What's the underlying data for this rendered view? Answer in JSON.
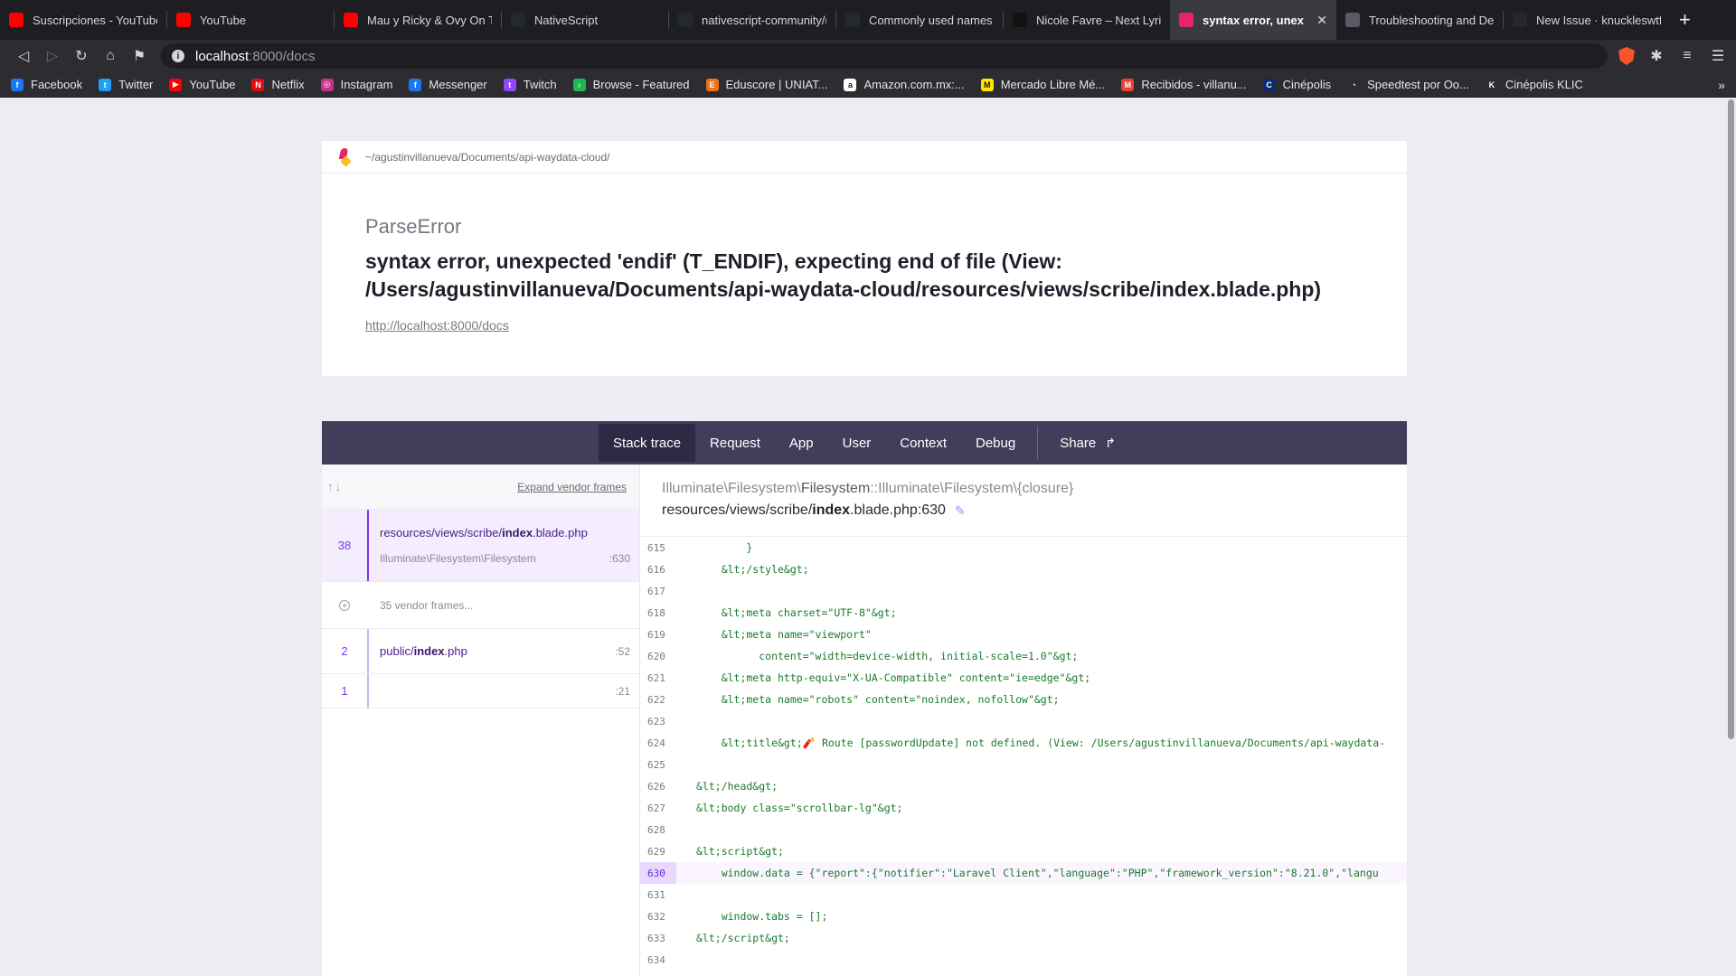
{
  "browser": {
    "tabs": [
      {
        "title": "Suscripciones - YouTube",
        "icon": "youtube-icon",
        "color": "#ff0000"
      },
      {
        "title": "YouTube",
        "icon": "youtube-icon",
        "color": "#ff0000"
      },
      {
        "title": "Mau y Ricky & Ovy On The",
        "icon": "youtube-icon",
        "color": "#ff0000"
      },
      {
        "title": "NativeScript",
        "icon": "github-icon",
        "color": "#24292e"
      },
      {
        "title": "nativescript-community/u",
        "icon": "github-icon",
        "color": "#24292e"
      },
      {
        "title": "Commonly used names fo",
        "icon": "github-icon",
        "color": "#24292e"
      },
      {
        "title": "Nicole Favre – Next Lyrics",
        "icon": "genius-icon",
        "color": "#111111"
      },
      {
        "title": "syntax error, unex",
        "icon": "ignition-icon",
        "color": "#e7236d",
        "active": true
      },
      {
        "title": "Troubleshooting and Deb",
        "icon": "docs-icon",
        "color": "#5a5a66"
      },
      {
        "title": "New Issue · knuckleswtf/s",
        "icon": "github-icon",
        "color": "#24292e"
      }
    ],
    "close_glyph": "✕",
    "newtab_glyph": "+",
    "url_host": "localhost",
    "url_path": ":8000/docs",
    "bookmarks": [
      {
        "label": "Facebook",
        "color": "#1877f2",
        "glyph": "f"
      },
      {
        "label": "Twitter",
        "color": "#1da1f2",
        "glyph": "t"
      },
      {
        "label": "YouTube",
        "color": "#ff0000",
        "glyph": "▶"
      },
      {
        "label": "Netflix",
        "color": "#e50914",
        "glyph": "N"
      },
      {
        "label": "Instagram",
        "color": "#c13584",
        "glyph": "◎"
      },
      {
        "label": "Messenger",
        "color": "#1877f2",
        "glyph": "f"
      },
      {
        "label": "Twitch",
        "color": "#9146ff",
        "glyph": "t"
      },
      {
        "label": "Browse - Featured",
        "color": "#1db954",
        "glyph": "♪"
      },
      {
        "label": "Eduscore | UNIAT...",
        "color": "#e8731a",
        "glyph": "E"
      },
      {
        "label": "Amazon.com.mx:...",
        "color": "#ffffff",
        "glyph": "a"
      },
      {
        "label": "Mercado Libre Mé...",
        "color": "#ffe600",
        "glyph": "M"
      },
      {
        "label": "Recibidos - villanu...",
        "color": "#ea4335",
        "glyph": "M"
      },
      {
        "label": "Cinépolis",
        "color": "#0a2a6b",
        "glyph": "C"
      },
      {
        "label": "Speedtest por Oo...",
        "color": "#2d2d31",
        "glyph": "◔"
      },
      {
        "label": "Cinépolis KLIC",
        "color": "#2d2d31",
        "glyph": "K"
      }
    ],
    "bookmarks_more": "»"
  },
  "error": {
    "path": "~/agustinvillanueva/Documents/api-waydata-cloud/",
    "class": "ParseError",
    "message": "syntax error, unexpected 'endif' (T_ENDIF), expecting end of file (View: /Users/agustinvillanueva/Documents/api-waydata-cloud/resources/views/scribe/index.blade.php)",
    "url": "http://localhost:8000/docs"
  },
  "stack_tabs": [
    "Stack trace",
    "Request",
    "App",
    "User",
    "Context",
    "Debug"
  ],
  "share_label": "Share",
  "frames_panel": {
    "expand_label": "Expand vendor frames",
    "frames": [
      {
        "num": "38",
        "file_pre": "resources/views/scribe/",
        "file_bold": "index",
        "file_post": ".blade.php",
        "class": "Illuminate\\Filesystem\\Filesystem",
        "line": ":630",
        "selected": true
      },
      {
        "num": "",
        "vendor": true,
        "label": "35 vendor frames..."
      },
      {
        "num": "2",
        "file_pre": "public/",
        "file_bold": "index",
        "file_post": ".php",
        "line": ":52"
      },
      {
        "num": "1",
        "file_pre": "",
        "file_bold": "",
        "file_post": "",
        "line": ":21"
      }
    ]
  },
  "code": {
    "class_pre": "Illuminate\\Filesystem\\",
    "class_bold": "Filesystem",
    "class_post": "::Illuminate\\Filesystem\\{closure}",
    "file_pre": "resources/views/scribe/",
    "file_bold": "index",
    "file_post": ".blade.php:630",
    "highlight_line": "630",
    "lines": [
      {
        "n": "615",
        "t": "        }"
      },
      {
        "n": "616",
        "t": "    &lt;/style&gt;"
      },
      {
        "n": "617",
        "t": ""
      },
      {
        "n": "618",
        "t": "    &lt;meta charset=\"UTF-8\"&gt;"
      },
      {
        "n": "619",
        "t": "    &lt;meta name=\"viewport\""
      },
      {
        "n": "620",
        "t": "          content=\"width=device-width, initial-scale=1.0\"&gt;"
      },
      {
        "n": "621",
        "t": "    &lt;meta http-equiv=\"X-UA-Compatible\" content=\"ie=edge\"&gt;"
      },
      {
        "n": "622",
        "t": "    &lt;meta name=\"robots\" content=\"noindex, nofollow\"&gt;"
      },
      {
        "n": "623",
        "t": ""
      },
      {
        "n": "624",
        "t": "    &lt;title&gt;🧨 Route [passwordUpdate] not defined. (View: /Users/agustinvillanueva/Documents/api-waydata-"
      },
      {
        "n": "625",
        "t": ""
      },
      {
        "n": "626",
        "t": "&lt;/head&gt;"
      },
      {
        "n": "627",
        "t": "&lt;body class=\"scrollbar-lg\"&gt;"
      },
      {
        "n": "628",
        "t": ""
      },
      {
        "n": "629",
        "t": "&lt;script&gt;"
      },
      {
        "n": "630",
        "t": "    window.data = {\"report\":{\"notifier\":\"Laravel Client\",\"language\":\"PHP\",\"framework_version\":\"8.21.0\",\"langu"
      },
      {
        "n": "631",
        "t": ""
      },
      {
        "n": "632",
        "t": "    window.tabs = [];"
      },
      {
        "n": "633",
        "t": "&lt;/script&gt;"
      },
      {
        "n": "634",
        "t": ""
      }
    ]
  }
}
